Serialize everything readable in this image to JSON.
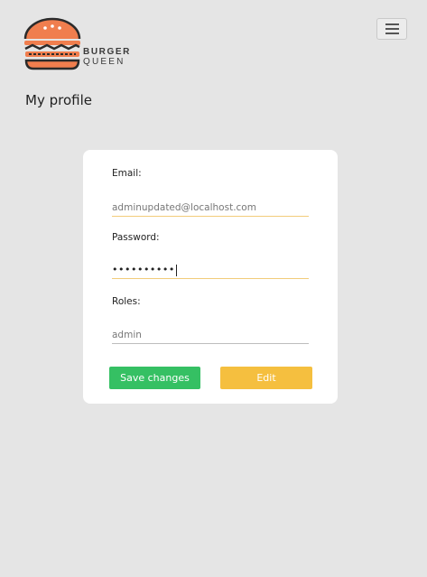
{
  "header": {
    "brand_top": "BURGER",
    "brand_bottom": "QUEEN",
    "logo_icon": "burger-logo-icon",
    "menu_icon": "hamburger-menu-icon"
  },
  "page": {
    "title": "My profile"
  },
  "form": {
    "email_label": "Email:",
    "email_value": "adminupdated@localhost.com",
    "password_label": "Password:",
    "password_value": "••••••••••",
    "roles_label": "Roles:",
    "roles_value": "admin"
  },
  "buttons": {
    "save": "Save changes",
    "edit": "Edit"
  },
  "colors": {
    "background": "#e5e5e5",
    "logo_orange": "#f07e4e",
    "save_green": "#35c063",
    "edit_yellow": "#f5bf3f",
    "field_underline": "#f2cc7a"
  }
}
